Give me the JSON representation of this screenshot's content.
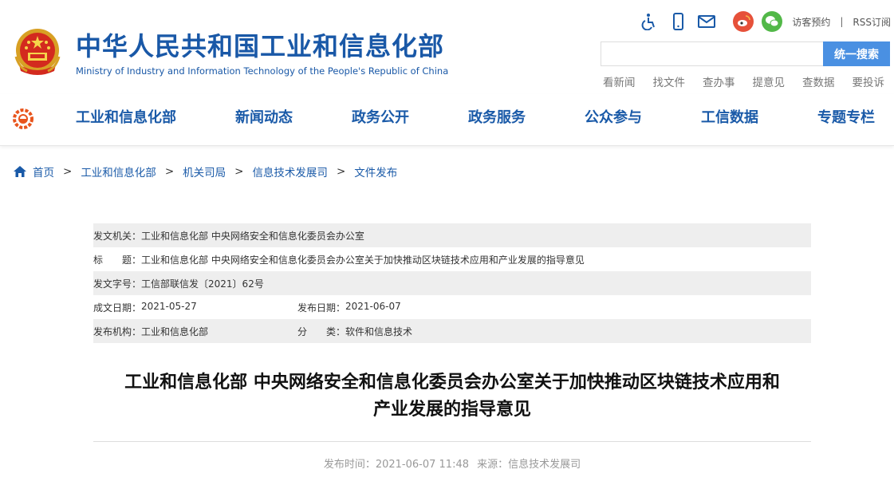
{
  "header": {
    "site_title": "中华人民共和国工业和信息化部",
    "site_subtitle": "Ministry of Industry and Information Technology of the People's Republic of China",
    "top_links": {
      "visitor": "访客预约",
      "separator": "|",
      "rss": "RSS订阅"
    },
    "icons": [
      "accessibility-icon",
      "mobile-icon",
      "mail-icon",
      "weibo-icon",
      "wechat-icon"
    ],
    "search": {
      "placeholder": "",
      "button": "统一搜索"
    },
    "quick_links": [
      "看新闻",
      "找文件",
      "查办事",
      "提意见",
      "查数据",
      "要投诉"
    ]
  },
  "nav": {
    "items": [
      "工业和信息化部",
      "新闻动态",
      "政务公开",
      "政务服务",
      "公众参与",
      "工信数据",
      "专题专栏"
    ]
  },
  "breadcrumb": {
    "items": [
      "首页",
      "工业和信息化部",
      "机关司局",
      "信息技术发展司",
      "文件发布"
    ],
    "arrow": ">"
  },
  "meta": {
    "issuer_label": "发文机关：",
    "issuer_value": "工业和信息化部 中央网络安全和信息化委员会办公室",
    "title_label": "标　　题：",
    "title_value": "工业和信息化部 中央网络安全和信息化委员会办公室关于加快推动区块链技术应用和产业发展的指导意见",
    "doc_no_label": "发文字号：",
    "doc_no_value": "工信部联信发〔2021〕62号",
    "created_label": "成文日期：",
    "created_value": "2021-05-27",
    "published_label": "发布日期：",
    "published_value": "2021-06-07",
    "publisher_label": "发布机构：",
    "publisher_value": "工业和信息化部",
    "category_label": "分　　类：",
    "category_value": "软件和信息技术"
  },
  "article": {
    "title_line1": "工业和信息化部 中央网络安全和信息化委员会办公室关于加快推动区块链技术应用和",
    "title_line2": "产业发展的指导意见",
    "publish_time": "发布时间：2021-06-07 11:48",
    "source": "来源：信息技术发展司"
  },
  "colors": {
    "brand": "#1958a7",
    "nav": "#1a5aa8",
    "search_button": "#4a90e2",
    "weibo": "#e6513a",
    "wechat": "#52b848"
  }
}
